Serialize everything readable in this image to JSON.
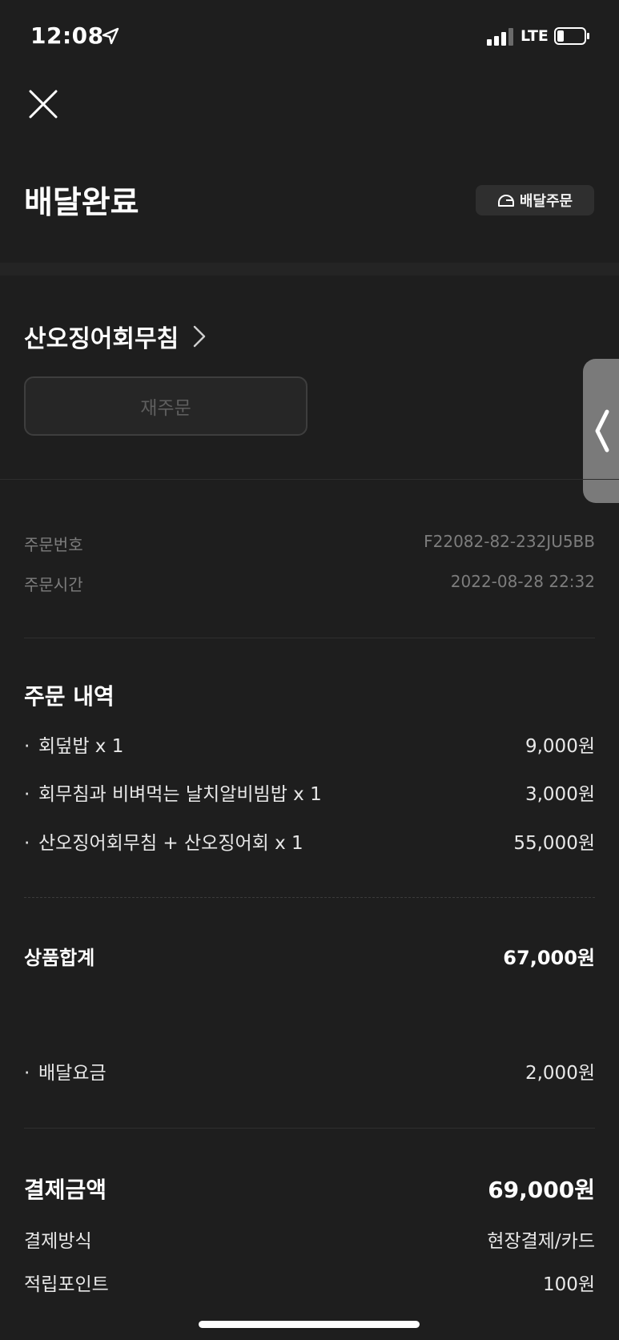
{
  "status_bar": {
    "time": "12:08",
    "network": "LTE"
  },
  "header": {
    "title": "배달완료",
    "badge": "배달주문"
  },
  "store": {
    "name": "산오징어회무침",
    "reorder_label": "재주문"
  },
  "order_info": [
    {
      "label": "주문번호",
      "value": "F22082-82-232JU5BB"
    },
    {
      "label": "주문시간",
      "value": "2022-08-28 22:32"
    }
  ],
  "order_details": {
    "title": "주문 내역",
    "items": [
      {
        "name": "회덮밥 x 1",
        "price": "9,000원"
      },
      {
        "name": "회무침과 비벼먹는 날치알비빔밥 x 1",
        "price": "3,000원"
      },
      {
        "name": "산오징어회무침 + 산오징어회 x 1",
        "price": "55,000원"
      }
    ]
  },
  "subtotal": {
    "label": "상품합계",
    "value": "67,000원"
  },
  "delivery_fee": {
    "label": "배달요금",
    "value": "2,000원"
  },
  "payment": {
    "total_label": "결제금액",
    "total_value": "69,000원",
    "method_label": "결제방식",
    "method_value": "현장결제/카드",
    "points_label": "적립포인트",
    "points_value": "100원"
  },
  "icons": [
    "location-arrow-icon",
    "signal-icon",
    "battery-icon",
    "close-icon",
    "helmet-icon",
    "chevron-right-icon",
    "chevron-left-icon"
  ],
  "colors": {
    "background": "#1e1e1e",
    "text": "#ffffff",
    "muted": "#7d7d7d",
    "badge_bg": "#2f2f2f"
  }
}
